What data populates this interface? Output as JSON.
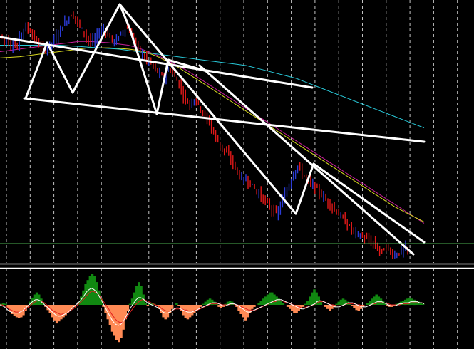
{
  "colors": {
    "background": "#000000",
    "grid": "#d8d8d8",
    "bull_candle": "#2b3bd6",
    "bear_candle": "#e01818",
    "trendline": "#ffffff",
    "ma_fast": "#c8209a",
    "ma_mid": "#d8d820",
    "ma_slow": "#28c8d8",
    "price_level": "#4caf50",
    "osc_positive": "#118811",
    "osc_negative": "#ff8a55",
    "osc_signal_a": "#ffffff",
    "osc_signal_b": "#e02020",
    "pane_separator": "#ffffff"
  },
  "chart_data": {
    "type": "candlestick",
    "main_pane": {
      "bar_count": 190,
      "close": [
        46,
        42,
        38,
        40,
        34,
        30,
        33,
        28,
        26,
        44,
        50,
        56,
        58,
        55,
        52,
        46,
        40,
        36,
        30,
        26,
        22,
        24,
        28,
        32,
        34,
        38,
        44,
        50,
        56,
        62,
        66,
        70,
        74,
        78,
        76,
        72,
        66,
        60,
        54,
        50,
        44,
        38,
        34,
        36,
        40,
        46,
        50,
        54,
        56,
        52,
        48,
        42,
        38,
        36,
        38,
        44,
        50,
        52,
        58,
        56,
        52,
        46,
        38,
        30,
        26,
        20,
        16,
        10,
        6,
        4,
        2,
        -4,
        -8,
        -12,
        -16,
        -20,
        -18,
        -14,
        -10,
        -8,
        -14,
        -20,
        -26,
        -32,
        -40,
        -48,
        -56,
        -60,
        -62,
        -58,
        -54,
        -58,
        -64,
        -70,
        -76,
        -82,
        -88,
        -92,
        -100,
        -108,
        -116,
        -122,
        -128,
        -132,
        -136,
        -140,
        -144,
        -150,
        -156,
        -162,
        -170,
        -176,
        -180,
        -184,
        -180,
        -184,
        -188,
        -192,
        -196,
        -200,
        -204,
        -208,
        -212,
        -216,
        -220,
        -224,
        -228,
        -232,
        -236,
        -230,
        -222,
        -214,
        -206,
        -196,
        -188,
        -180,
        -172,
        -164,
        -160,
        -166,
        -172,
        -176,
        -180,
        -184,
        -188,
        -190,
        -194,
        -198,
        -202,
        -206,
        -210,
        -214,
        -216,
        -220,
        -224,
        -228,
        -232,
        -236,
        -240,
        -244,
        -248,
        -252,
        -256,
        -260,
        -262,
        -266,
        -268,
        -270,
        -272,
        -274,
        -276,
        -278,
        -280,
        -282,
        -286,
        -290,
        -292,
        -294,
        -290,
        -288,
        -292,
        -296,
        -298,
        -300,
        -298,
        -296,
        -294,
        -292,
        -290,
        -292
      ],
      "moving_averages": [
        {
          "id": "ma_fast",
          "values": [
            20,
            22,
            24,
            26,
            28,
            30,
            32,
            34,
            36,
            36,
            35,
            34,
            32,
            30,
            26,
            20,
            14,
            6,
            -2,
            -10,
            -20,
            -30,
            -40,
            -50,
            -60,
            -70,
            -80,
            -90,
            -100,
            -110,
            -120,
            -130,
            -140,
            -150,
            -160,
            -170,
            -180,
            -190,
            -200,
            -210,
            -220,
            -230,
            -240,
            -250
          ]
        },
        {
          "id": "ma_mid",
          "values": [
            10,
            11,
            12,
            14,
            16,
            18,
            20,
            22,
            24,
            26,
            26,
            26,
            25,
            24,
            22,
            18,
            12,
            4,
            -4,
            -14,
            -24,
            -34,
            -44,
            -54,
            -64,
            -74,
            -84,
            -94,
            -104,
            -114,
            -124,
            -134,
            -144,
            -154,
            -164,
            -174,
            -184,
            -194,
            -204,
            -214,
            -224,
            -232,
            -240,
            -248
          ]
        },
        {
          "id": "ma_slow",
          "values": [
            30,
            30,
            30,
            30,
            30,
            30,
            30,
            29,
            28,
            27,
            26,
            25,
            24,
            22,
            20,
            18,
            16,
            14,
            12,
            10,
            8,
            6,
            4,
            2,
            0,
            -2,
            -6,
            -10,
            -14,
            -18,
            -22,
            -28,
            -34,
            -40,
            -46,
            -52,
            -58,
            -64,
            -70,
            -76,
            -82,
            -88,
            -94,
            -100
          ]
        }
      ]
    },
    "oscillator_pane": {
      "zero": 0,
      "histogram": [
        1,
        2,
        1,
        -3,
        -6,
        -9,
        -11,
        -12,
        -13,
        -12,
        -10,
        -6,
        -2,
        3,
        7,
        10,
        12,
        10,
        6,
        2,
        -2,
        -5,
        -8,
        -12,
        -15,
        -18,
        -16,
        -14,
        -12,
        -10,
        -8,
        -6,
        -4,
        -2,
        0,
        3,
        8,
        14,
        20,
        24,
        28,
        30,
        28,
        22,
        14,
        6,
        -2,
        -8,
        -14,
        -20,
        -26,
        -30,
        -34,
        -36,
        -32,
        -24,
        -14,
        -6,
        1,
        6,
        12,
        18,
        22,
        18,
        10,
        2,
        -1,
        1,
        2,
        1,
        -1,
        -4,
        -8,
        -12,
        -14,
        -12,
        -8,
        -4,
        0,
        2,
        -1,
        -6,
        -10,
        -13,
        -14,
        -12,
        -10,
        -8,
        -6,
        -4,
        -2,
        1,
        3,
        5,
        6,
        5,
        3,
        1,
        -2,
        -3,
        -2,
        1,
        3,
        4,
        3,
        1,
        -2,
        -6,
        -9,
        -12,
        -15,
        -12,
        -8,
        -4,
        -2,
        0,
        2,
        4,
        6,
        8,
        10,
        12,
        12,
        10,
        8,
        6,
        4,
        2,
        0,
        -2,
        -4,
        -6,
        -8,
        -8,
        -6,
        -4,
        -2,
        1,
        4,
        8,
        12,
        15,
        12,
        8,
        4,
        0,
        -2,
        -4,
        -6,
        -4,
        -2,
        1,
        3,
        5,
        6,
        5,
        3,
        1,
        -1,
        -3,
        -5,
        -6,
        -4,
        -2,
        0,
        2,
        4,
        6,
        8,
        10,
        8,
        6,
        4,
        2,
        -1,
        -2,
        -2,
        -1,
        1,
        2,
        3,
        4,
        5,
        6,
        7,
        6,
        5,
        4,
        3,
        2,
        1
      ],
      "signal_a": [
        0,
        -1,
        -2,
        -4,
        -6,
        -7,
        -8,
        -8,
        -8,
        -7,
        -6,
        -4,
        -2,
        0,
        2,
        4,
        5,
        5,
        4,
        2,
        0,
        -2,
        -4,
        -6,
        -8,
        -10,
        -11,
        -11,
        -10,
        -9,
        -8,
        -6,
        -4,
        -2,
        0,
        2,
        4,
        7,
        10,
        13,
        15,
        16,
        15,
        13,
        10,
        6,
        2,
        -2,
        -6,
        -10,
        -14,
        -17,
        -19,
        -20,
        -19,
        -17,
        -13,
        -9,
        -5,
        -1,
        2,
        5,
        7,
        7,
        6,
        4,
        2,
        1,
        0,
        -1,
        -2,
        -3,
        -5,
        -7,
        -8,
        -8,
        -7,
        -6,
        -4,
        -3,
        -3,
        -4,
        -5,
        -6,
        -7,
        -7,
        -7,
        -6,
        -5,
        -4,
        -3,
        -2,
        -1,
        0,
        1,
        2,
        2,
        2,
        1,
        0,
        -1,
        -1,
        0,
        1,
        1,
        1,
        0,
        -1,
        -3,
        -4,
        -6,
        -7,
        -7,
        -6,
        -5,
        -4,
        -3,
        -2,
        -1,
        0,
        1,
        2,
        3,
        4,
        5,
        5,
        5,
        4,
        3,
        2,
        1,
        0,
        -1,
        -2,
        -3,
        -4,
        -4,
        -3,
        -2,
        -1,
        0,
        1,
        3,
        4,
        4,
        3,
        2,
        1,
        0,
        -1,
        -2,
        -2,
        -2,
        -1,
        0,
        1,
        2,
        2,
        2,
        1,
        0,
        -1,
        -2,
        -2,
        -2,
        -1,
        0,
        1,
        2,
        3,
        3,
        3,
        2,
        1,
        0,
        -1,
        -1,
        -1,
        0,
        1,
        1,
        2,
        2,
        2,
        3,
        3,
        3,
        3,
        2,
        2,
        1
      ],
      "signal_b": [
        0,
        0,
        -1,
        -2,
        -4,
        -5,
        -6,
        -7,
        -7,
        -7,
        -6,
        -5,
        -3,
        -2,
        0,
        2,
        3,
        4,
        4,
        3,
        2,
        0,
        -2,
        -4,
        -6,
        -7,
        -8,
        -9,
        -9,
        -8,
        -8,
        -7,
        -5,
        -4,
        -2,
        0,
        2,
        4,
        6,
        9,
        11,
        13,
        13,
        12,
        11,
        8,
        5,
        2,
        -1,
        -4,
        -8,
        -11,
        -14,
        -16,
        -17,
        -17,
        -15,
        -12,
        -9,
        -6,
        -3,
        0,
        2,
        4,
        5,
        5,
        4,
        3,
        2,
        1,
        0,
        -1,
        -2,
        -4,
        -5,
        -6,
        -6,
        -6,
        -5,
        -4,
        -4,
        -4,
        -4,
        -5,
        -5,
        -6,
        -6,
        -6,
        -5,
        -5,
        -4,
        -3,
        -2,
        -1,
        0,
        1,
        1,
        1,
        1,
        1,
        0,
        0,
        0,
        0,
        1,
        1,
        0,
        0,
        -1,
        -2,
        -3,
        -4,
        -5,
        -5,
        -5,
        -5,
        -4,
        -3,
        -2,
        -1,
        0,
        1,
        2,
        3,
        3,
        4,
        4,
        4,
        3,
        2,
        2,
        1,
        0,
        -1,
        -2,
        -2,
        -3,
        -3,
        -2,
        -2,
        -1,
        0,
        1,
        2,
        3,
        3,
        3,
        2,
        1,
        0,
        0,
        -1,
        -1,
        -1,
        -1,
        0,
        1,
        1,
        1,
        1,
        1,
        0,
        0,
        -1,
        -1,
        -1,
        -1,
        0,
        1,
        1,
        2,
        2,
        2,
        2,
        1,
        1,
        0,
        0,
        0,
        0,
        0,
        1,
        1,
        1,
        1,
        2,
        2,
        2,
        2,
        2,
        2,
        1
      ]
    }
  }
}
